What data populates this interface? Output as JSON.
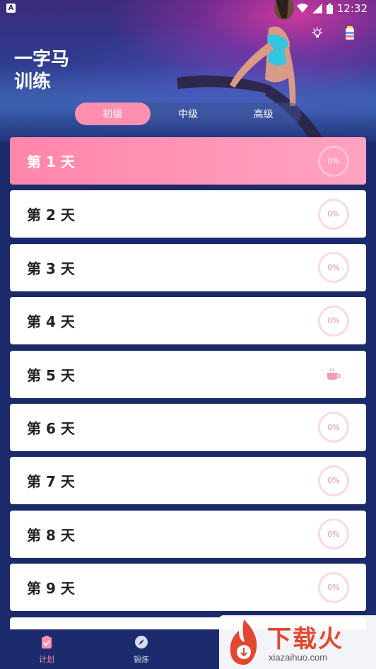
{
  "status_bar": {
    "left_badge": "A",
    "time": "12:32"
  },
  "header": {
    "title": "一字马\n训练",
    "icons": [
      "lightbulb-icon",
      "bottle-icon"
    ]
  },
  "level_tabs": [
    {
      "label": "初级",
      "active": true
    },
    {
      "label": "中级",
      "active": false
    },
    {
      "label": "高级",
      "active": false
    }
  ],
  "days": [
    {
      "label": "第 1 天",
      "progress": "0%",
      "active": true,
      "rest": false
    },
    {
      "label": "第 2 天",
      "progress": "0%",
      "active": false,
      "rest": false
    },
    {
      "label": "第 3 天",
      "progress": "0%",
      "active": false,
      "rest": false
    },
    {
      "label": "第 4 天",
      "progress": "0%",
      "active": false,
      "rest": false
    },
    {
      "label": "第 5 天",
      "progress": "",
      "active": false,
      "rest": true
    },
    {
      "label": "第 6 天",
      "progress": "0%",
      "active": false,
      "rest": false
    },
    {
      "label": "第 7 天",
      "progress": "0%",
      "active": false,
      "rest": false
    },
    {
      "label": "第 8 天",
      "progress": "0%",
      "active": false,
      "rest": false
    },
    {
      "label": "第 9 天",
      "progress": "0%",
      "active": false,
      "rest": false
    }
  ],
  "bottom_nav": [
    {
      "label": "计划",
      "icon": "clipboard-icon",
      "active": true
    },
    {
      "label": "锻炼",
      "icon": "compass-icon",
      "active": false
    }
  ],
  "watermark": {
    "text": "下载火",
    "sub": "xiazaihuo.com"
  },
  "colors": {
    "accent": "#ff8fb1",
    "background": "#1b2a6b"
  }
}
